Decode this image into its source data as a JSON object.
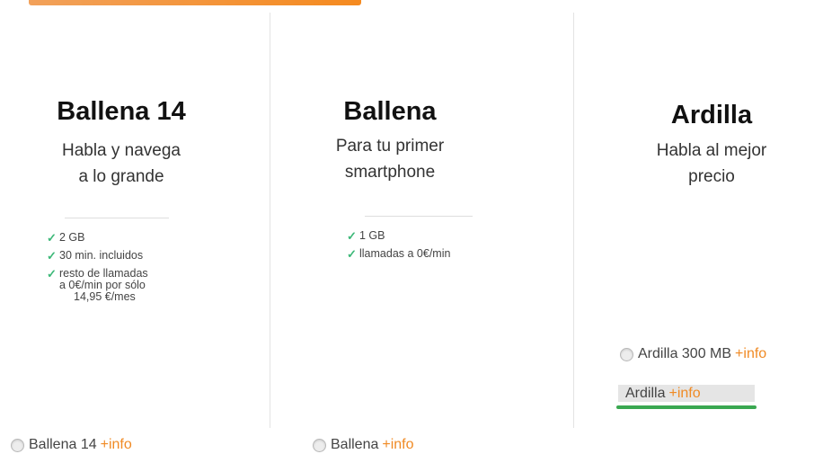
{
  "plans": [
    {
      "title": "Ballena 14",
      "subtitle_line1": "Habla y navega",
      "subtitle_line2": "a lo grande",
      "features": [
        "2 GB",
        "30 min. incluidos",
        "resto de llamadas",
        "a 0€/min por sólo",
        "14,95 €/mes"
      ],
      "option_label": "Ballena 14",
      "info_link": "+info"
    },
    {
      "title": "Ballena",
      "subtitle_line1": "Para tu primer",
      "subtitle_line2": "smartphone",
      "features": [
        "1 GB",
        "llamadas a 0€/min"
      ],
      "option_label": "Ballena",
      "info_link": "+info"
    },
    {
      "title": "Ardilla",
      "subtitle_line1": "Habla al mejor",
      "subtitle_line2": "precio",
      "options": [
        {
          "label": "Ardilla 300 MB",
          "info_link": "+info"
        },
        {
          "label": "Ardilla",
          "info_link": "+info",
          "selected": true
        }
      ]
    }
  ],
  "colors": {
    "accent": "#f08a24",
    "check": "#3cb878",
    "selected_underline": "#3aa851"
  },
  "icons": [
    "check-icon",
    "radio-icon"
  ]
}
